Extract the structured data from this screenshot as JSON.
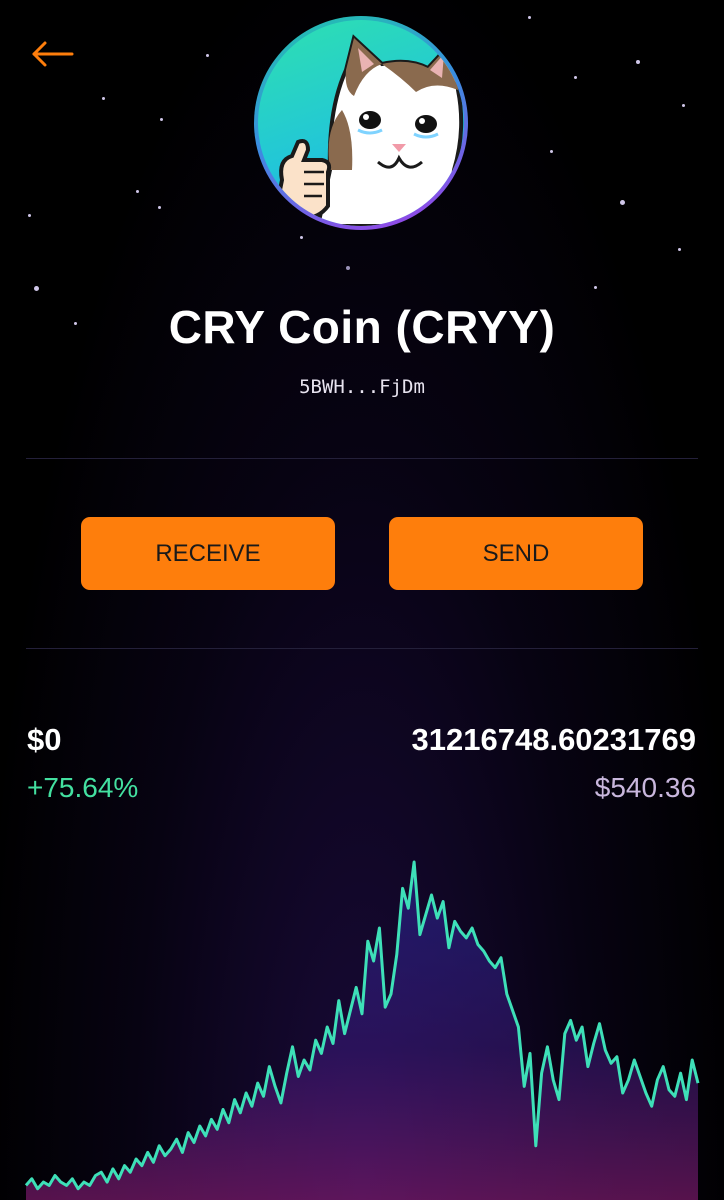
{
  "header": {
    "back_icon": "arrow-left-icon",
    "accent_color": "#fe7e0c"
  },
  "token": {
    "name": "CRY Coin (CRYY)",
    "address": "5BWH...FjDm",
    "avatar": "crying-cat-thumbs-up-image"
  },
  "actions": {
    "receive_label": "RECEIVE",
    "send_label": "SEND"
  },
  "stats": {
    "price": "$0",
    "change": "+75.64%",
    "balance": "31216748.60231769",
    "value": "$540.36"
  },
  "colors": {
    "positive": "#43e0a0",
    "chart_line": "#3ee0b8",
    "value_text": "#c9b7dd"
  },
  "chart_data": {
    "type": "line",
    "title": "",
    "xlabel": "",
    "ylabel": "",
    "grid": false,
    "legend": "none",
    "ylim": [
      0,
      100
    ],
    "series": [
      {
        "values": [
          2,
          4,
          1,
          3,
          2,
          5,
          3,
          2,
          4,
          1,
          3,
          2,
          5,
          6,
          3,
          7,
          4,
          8,
          6,
          10,
          8,
          12,
          9,
          14,
          11,
          13,
          16,
          12,
          18,
          15,
          20,
          17,
          22,
          19,
          25,
          21,
          28,
          24,
          30,
          26,
          33,
          29,
          38,
          32,
          27,
          36,
          44,
          35,
          40,
          37,
          46,
          42,
          50,
          45,
          58,
          48,
          55,
          62,
          54,
          76,
          70,
          80,
          56,
          60,
          72,
          92,
          86,
          100,
          78,
          84,
          90,
          83,
          88,
          74,
          82,
          79,
          77,
          80,
          75,
          73,
          70,
          68,
          71,
          60,
          55,
          50,
          32,
          42,
          14,
          36,
          44,
          34,
          28,
          48,
          52,
          46,
          50,
          38,
          45,
          51,
          43,
          39,
          41,
          30,
          34,
          40,
          35,
          30,
          26,
          34,
          38,
          31,
          29,
          36,
          28,
          40,
          33
        ]
      }
    ]
  }
}
